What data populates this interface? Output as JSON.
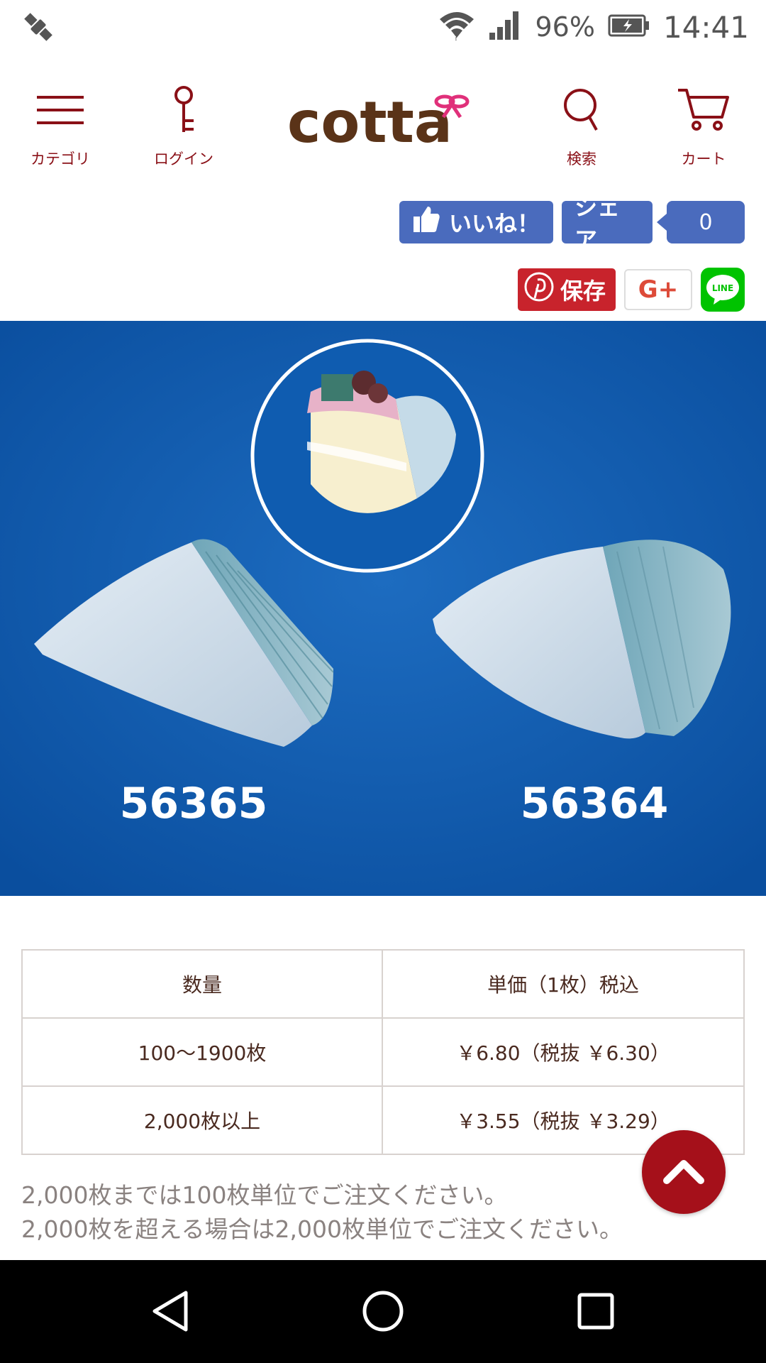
{
  "status_bar": {
    "battery": "96%",
    "time": "14:41"
  },
  "header": {
    "menu_label": "カテゴリ",
    "login_label": "ログイン",
    "logo_text": "cotta",
    "search_label": "検索",
    "cart_label": "カート"
  },
  "social": {
    "like_label": "いいね！",
    "share_label": "シェア",
    "count": "0",
    "pinterest_label": "保存",
    "gplus_label": "G+",
    "line_label": "LINE"
  },
  "product_image": {
    "codes": [
      "56365",
      "56364"
    ],
    "background_color": "#0a56a8"
  },
  "price_table": {
    "headers": [
      "数量",
      "単価（1枚）税込"
    ],
    "rows": [
      [
        "100〜1900枚",
        "￥6.80（税抜 ￥6.30）"
      ],
      [
        "2,000枚以上",
        "￥3.55（税抜 ￥3.29）"
      ]
    ]
  },
  "notes": [
    "2,000枚までは100枚単位でご注文ください。",
    "2,000枚を超える場合は2,000枚単位でご注文ください。"
  ],
  "colors": {
    "brand": "#8a1017",
    "facebook": "#4a6bbd",
    "pinterest": "#c8232c",
    "line": "#00c300"
  }
}
